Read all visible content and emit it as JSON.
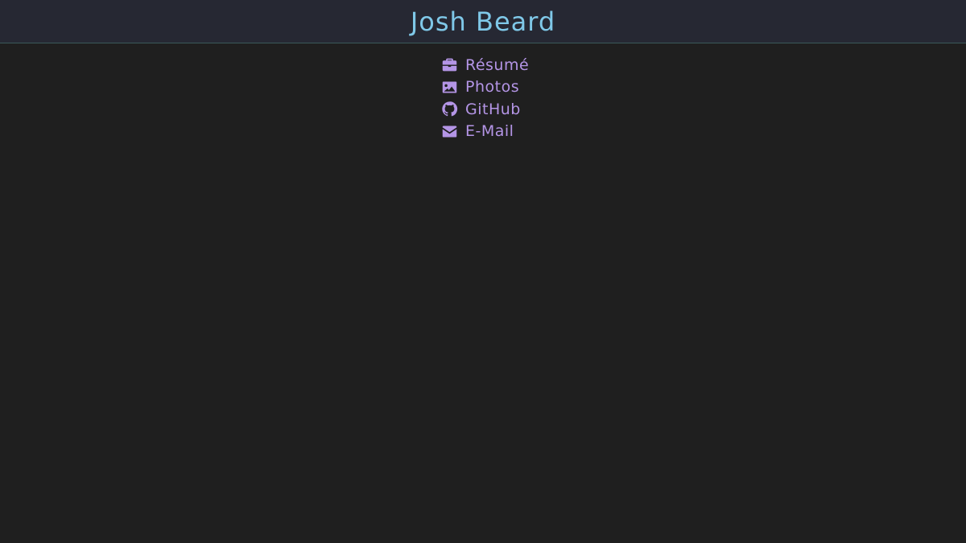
{
  "header": {
    "title": "Josh Beard"
  },
  "links": [
    {
      "label": "Résumé",
      "icon": "briefcase-icon"
    },
    {
      "label": "Photos",
      "icon": "image-icon"
    },
    {
      "label": "GitHub",
      "icon": "github-icon"
    },
    {
      "label": "E-Mail",
      "icon": "envelope-icon"
    }
  ],
  "colors": {
    "background": "#1f1f1f",
    "header_background": "#262833",
    "title": "#7fc8e8",
    "link": "#b495e6"
  }
}
